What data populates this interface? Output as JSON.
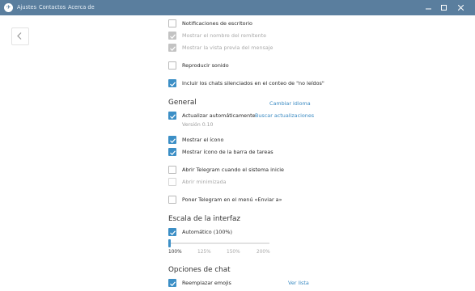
{
  "titlebar": {
    "menu": [
      "Ajustes",
      "Contactos",
      "Acerca de"
    ]
  },
  "notifications": {
    "desktop": {
      "label": "Notificaciones de escritorio",
      "checked": false
    },
    "show_sender": {
      "label": "Mostrar el nombre del remitente",
      "checked": true,
      "disabled": true
    },
    "show_preview": {
      "label": "Mostrar la vista previa del mensaje",
      "checked": true,
      "disabled": true
    },
    "play_sound": {
      "label": "Reproducir sonido",
      "checked": false
    },
    "include_muted": {
      "label": "Incluir los chats silenciados en el conteo de \"no leídos\"",
      "checked": true
    }
  },
  "general": {
    "title": "General",
    "change_language": "Cambiar idioma",
    "auto_update": {
      "label": "Actualizar automáticamente",
      "checked": true
    },
    "check_updates": "Buscar actualizaciones",
    "version": "Versión 0.10",
    "tray_icon": {
      "label": "Mostrar el ícono",
      "checked": true
    },
    "taskbar_icon": {
      "label": "Mostrar ícono de la barra de tareas",
      "checked": true
    },
    "autostart": {
      "label": "Abrir Telegram cuando el sistema inicie",
      "checked": false
    },
    "start_minimized": {
      "label": "Abrir minimizada",
      "checked": false,
      "disabled": true
    },
    "send_to_menu": {
      "label": "Poner Telegram en el menú «Enviar a»",
      "checked": false
    }
  },
  "scale": {
    "title": "Escala de la interfaz",
    "auto": {
      "label": "Automático (100%)",
      "checked": true
    },
    "ticks": [
      "100%",
      "125%",
      "150%",
      "200%"
    ],
    "selected_index": 0
  },
  "chat_options": {
    "title": "Opciones de chat",
    "replace_emoji": {
      "label": "Reemplazar emojis",
      "checked": true
    },
    "view_list": "Ver lista"
  },
  "colors": {
    "titlebar": "#5a7e9e",
    "accent": "#3c8fc6",
    "link": "#3a8ac2"
  }
}
